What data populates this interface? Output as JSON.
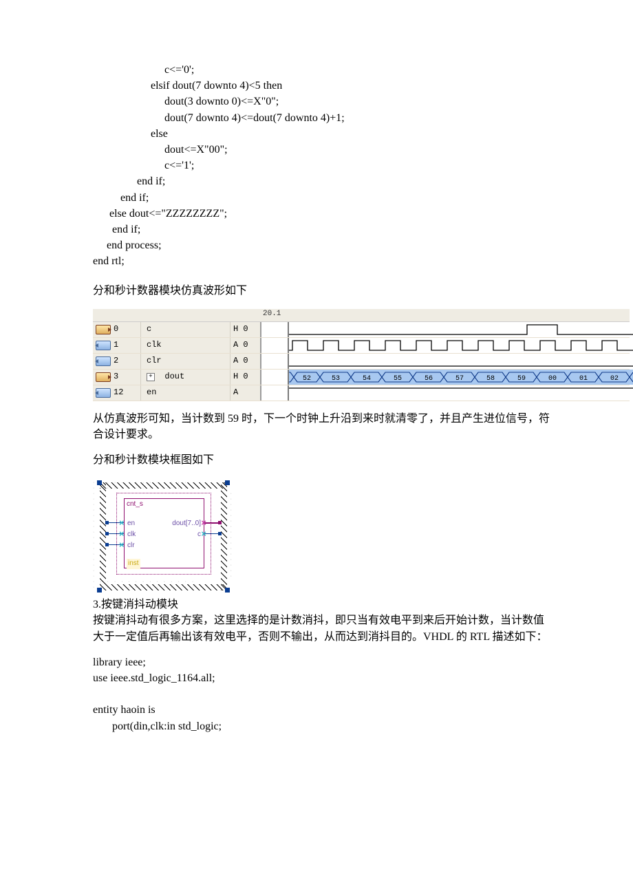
{
  "code_block_top": "                          c<='0';\n                     elsif dout(7 downto 4)<5 then\n                          dout(3 downto 0)<=X\"0\";\n                          dout(7 downto 4)<=dout(7 downto 4)+1;\n                     else\n                          dout<=X\"00\";\n                          c<='1';\n                end if;\n          end if;\n      else dout<=\"ZZZZZZZZ\";\n       end if;\n     end process;\nend rtl;",
  "para_wave_title": "分和秒计数器模块仿真波形如下",
  "wave": {
    "tick_label": "20.1",
    "rows": [
      {
        "pin_idx": "0",
        "icon": "out",
        "name": "c",
        "val": "H 0"
      },
      {
        "pin_idx": "1",
        "icon": "in",
        "name": "clk",
        "val": "A 0"
      },
      {
        "pin_idx": "2",
        "icon": "in",
        "name": "clr",
        "val": "A 0"
      },
      {
        "pin_idx": "3",
        "icon": "out",
        "name": "dout",
        "val": "H 0",
        "expand": true,
        "selected": true
      },
      {
        "pin_idx": "12",
        "icon": "in",
        "name": "en",
        "val": "A"
      }
    ],
    "bus_values": [
      "52",
      "53",
      "54",
      "55",
      "56",
      "57",
      "58",
      "59",
      "00",
      "01",
      "02"
    ]
  },
  "para_wave_desc": "从仿真波形可知，当计数到 59 时，下一个时钟上升沿到来时就清零了，并且产生进位信号，符合设计要求。",
  "para_block_title": "分和秒计数模块框图如下",
  "block": {
    "module_name": "cnt_s",
    "inst": "inst",
    "ports_in": [
      "en",
      "clk",
      "clr"
    ],
    "port_dout": "dout[7..0]",
    "port_c": "c"
  },
  "section3_title": "3.按键消抖动模块",
  "section3_body": "按键消抖动有很多方案，这里选择的是计数消抖，即只当有效电平到来后开始计数，当计数值大于一定值后再输出该有效电平，否则不输出，从而达到消抖目的。VHDL 的 RTL 描述如下：",
  "code_block_bottom": "library ieee;\nuse ieee.std_logic_1164.all;\n\nentity haoin is\n       port(din,clk:in std_logic;"
}
